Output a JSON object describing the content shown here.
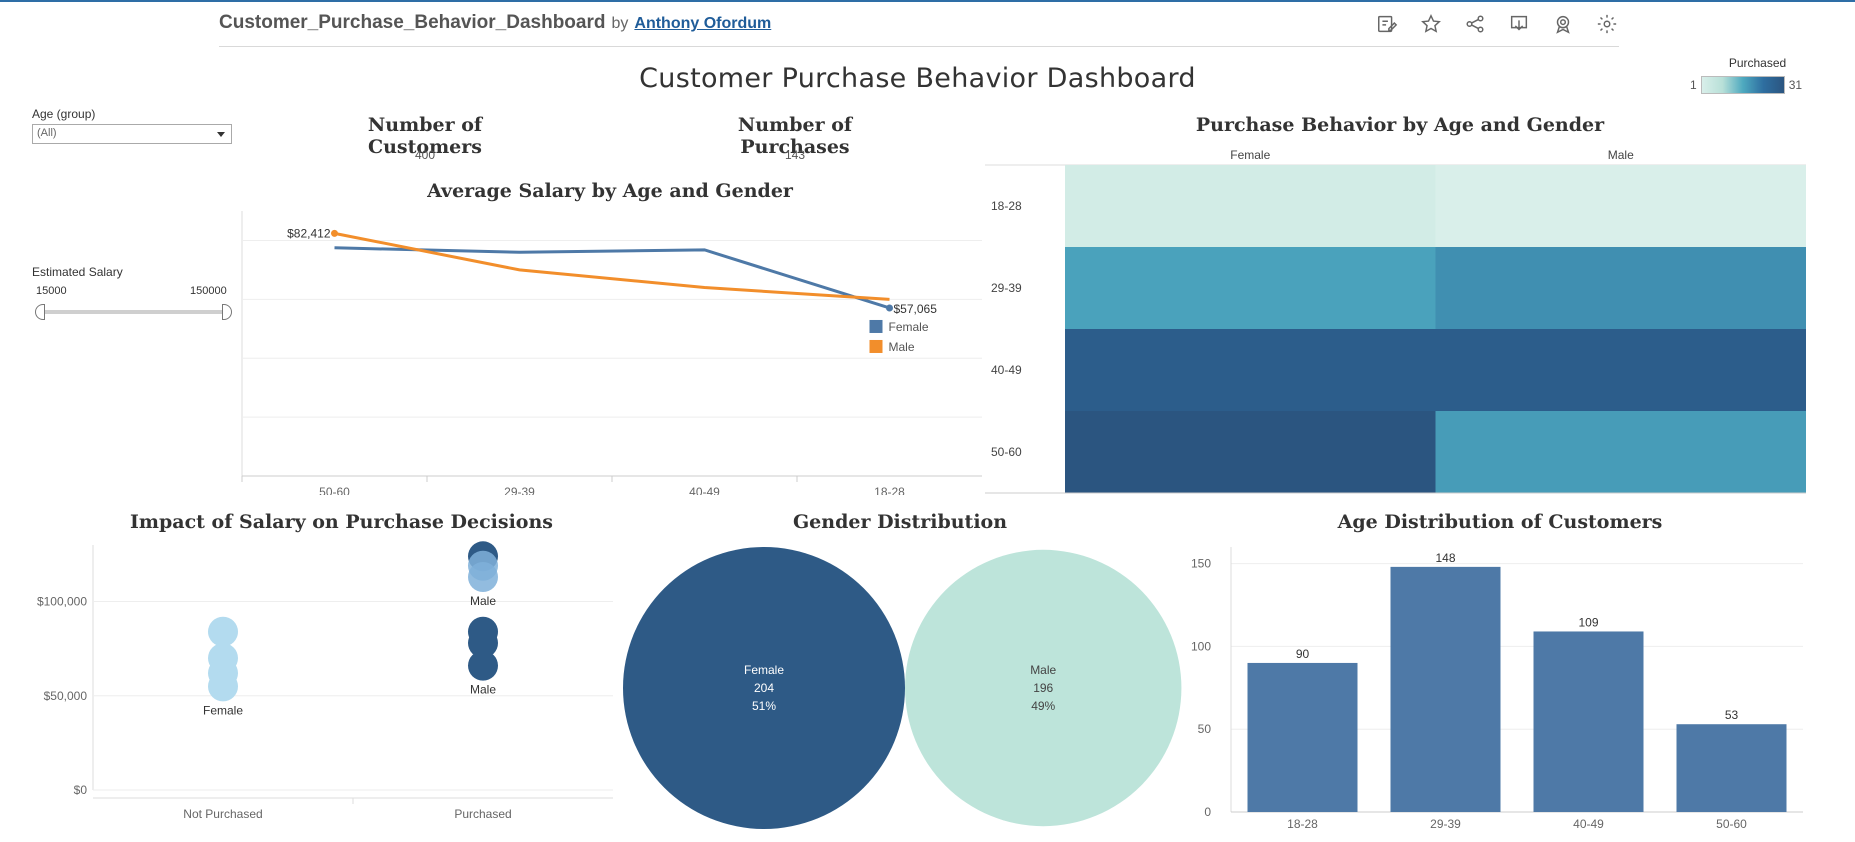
{
  "toolbar": {
    "workbook_title": "Customer_Purchase_Behavior_Dashboard",
    "by_label": "by",
    "author": "Anthony Ofordum",
    "icons": [
      "edit-icon",
      "star-icon",
      "share-icon",
      "download-icon",
      "metrics-icon",
      "settings-icon"
    ]
  },
  "dashboard": {
    "title": "Customer Purchase Behavior Dashboard",
    "legend": {
      "title": "Purchased",
      "min_label": "1",
      "max_label": "31"
    }
  },
  "filters": {
    "age": {
      "label": "Age (group)",
      "value": "(All)"
    },
    "salary": {
      "label": "Estimated Salary",
      "min": "15000",
      "max": "150000"
    }
  },
  "kpis": {
    "customers": {
      "title": "Number of Customers",
      "value": "400"
    },
    "purchases": {
      "title": "Number of Purchases",
      "value": "143"
    }
  },
  "colors": {
    "female": "#4e79a7",
    "male": "#f28e2b",
    "dark_blue": "#2e5a86",
    "light_teal": "#bde4da",
    "light_blue": "#b3dbef"
  },
  "chart_data": [
    {
      "id": "avg_salary",
      "type": "line",
      "title": "Average Salary by Age and Gender",
      "categories": [
        "50-60",
        "29-39",
        "40-49",
        "18-28"
      ],
      "series": [
        {
          "name": "Female",
          "values": [
            77500,
            76000,
            76800,
            57065
          ]
        },
        {
          "name": "Male",
          "values": [
            82412,
            70000,
            64000,
            60000
          ]
        }
      ],
      "labels": [
        "$82,412",
        "$57,065"
      ],
      "ylim": [
        0,
        90000
      ],
      "grid": true,
      "legend": "right"
    },
    {
      "id": "heatmap",
      "type": "heatmap",
      "title": "Purchase Behavior by Age and Gender",
      "columns": [
        "Female",
        "Male"
      ],
      "rows": [
        "18-28",
        "29-39",
        "40-49",
        "50-60"
      ],
      "values": [
        [
          2,
          1
        ],
        [
          17,
          20
        ],
        [
          29,
          29
        ],
        [
          31,
          18
        ]
      ],
      "scale": [
        1,
        31
      ]
    },
    {
      "id": "impact",
      "type": "scatter",
      "title": "Impact of Salary on Purchase Decisions",
      "categories": [
        "Not Purchased",
        "Purchased"
      ],
      "y_ticks": [
        "$0",
        "$50,000",
        "$100,000"
      ],
      "ylim": [
        0,
        130000
      ],
      "points": [
        {
          "x": "Not Purchased",
          "y": 84000,
          "label": "",
          "gender": "Female"
        },
        {
          "x": "Not Purchased",
          "y": 70000,
          "label": "",
          "gender": "Female"
        },
        {
          "x": "Not Purchased",
          "y": 62000,
          "label": "",
          "gender": "Female"
        },
        {
          "x": "Not Purchased",
          "y": 55000,
          "label": "Female",
          "gender": "Female"
        },
        {
          "x": "Purchased",
          "y": 124000,
          "label": "",
          "gender": "Male"
        },
        {
          "x": "Purchased",
          "y": 119000,
          "label": "",
          "gender": "Female"
        },
        {
          "x": "Purchased",
          "y": 113000,
          "label": "Male",
          "gender": "Female"
        },
        {
          "x": "Purchased",
          "y": 84000,
          "label": "",
          "gender": "Male"
        },
        {
          "x": "Purchased",
          "y": 78000,
          "label": "",
          "gender": "Male"
        },
        {
          "x": "Purchased",
          "y": 66000,
          "label": "Male",
          "gender": "Male"
        }
      ]
    },
    {
      "id": "gender",
      "type": "pie",
      "title": "Gender Distribution",
      "slices": [
        {
          "name": "Female",
          "value": 204,
          "percent": "51%"
        },
        {
          "name": "Male",
          "value": 196,
          "percent": "49%"
        }
      ]
    },
    {
      "id": "age_dist",
      "type": "bar",
      "title": "Age Distribution of Customers",
      "categories": [
        "18-28",
        "29-39",
        "40-49",
        "50-60"
      ],
      "values": [
        90,
        148,
        109,
        53
      ],
      "y_ticks": [
        "0",
        "50",
        "100",
        "150"
      ],
      "ylim": [
        0,
        160
      ]
    }
  ]
}
